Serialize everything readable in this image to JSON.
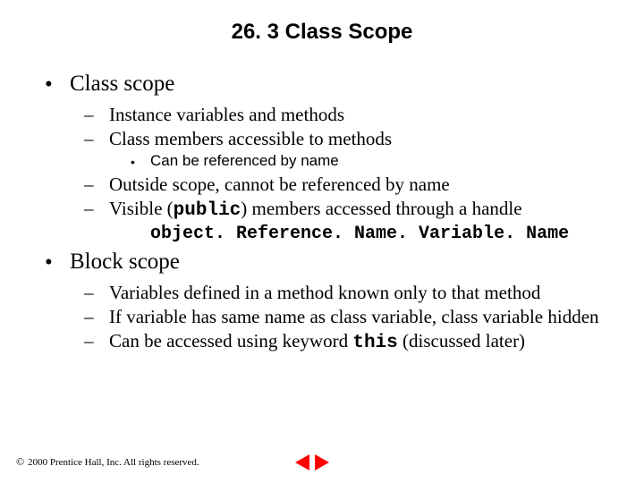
{
  "title": "26. 3  Class Scope",
  "bullets": {
    "b1_class_scope": "Class scope",
    "b2_instance_vars": "Instance variables and methods",
    "b2_members": "Class members accessible to methods",
    "b3_refname": "Can be referenced by name",
    "b2_outside": "Outside scope, cannot be referenced by name",
    "b2_visible_pre": "Visible (",
    "b2_visible_code": "public",
    "b2_visible_post": ") members accessed through a handle",
    "code_line": "object. Reference. Name. Variable. Name",
    "b1_block_scope": "Block scope",
    "b2_vars_method": "Variables defined in a method known only to that method",
    "b2_same_name": "If variable has same name as class variable, class variable hidden",
    "b2_accessed_pre": "Can be accessed using keyword ",
    "b2_accessed_code": "this",
    "b2_accessed_post": " (discussed later)"
  },
  "footer": {
    "copyright_symbol": "©",
    "text": "2000 Prentice Hall, Inc. All rights reserved."
  }
}
